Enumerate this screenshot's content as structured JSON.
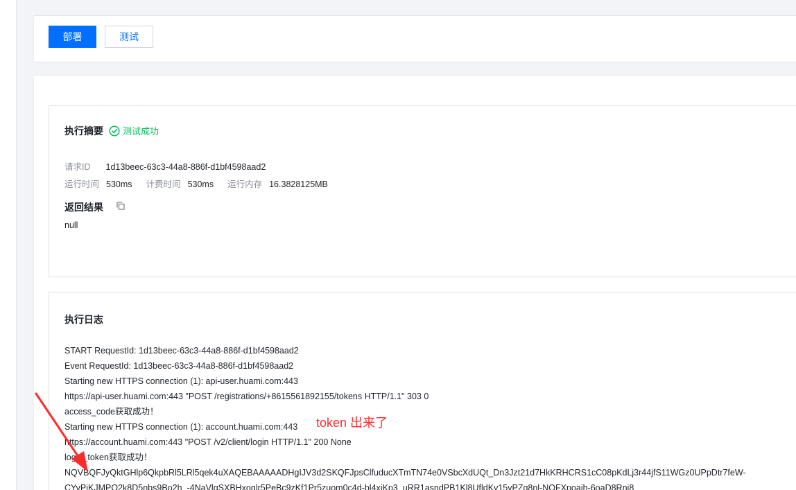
{
  "toolbar": {
    "deploy_label": "部署",
    "test_label": "测试"
  },
  "summary": {
    "title": "执行摘要",
    "status": "测试成功",
    "request_id_label": "请求ID",
    "request_id": "1d13beec-63c3-44a8-886f-d1bf4598aad2",
    "run_time_label": "运行时间",
    "run_time": "530ms",
    "bill_time_label": "计费时间",
    "bill_time": "530ms",
    "memory_label": "运行内存",
    "memory": "16.3828125MB",
    "result_title": "返回结果",
    "result_value": "null"
  },
  "log": {
    "title": "执行日志",
    "lines": [
      "START RequestId: 1d13beec-63c3-44a8-886f-d1bf4598aad2",
      "Event RequestId: 1d13beec-63c3-44a8-886f-d1bf4598aad2",
      "Starting new HTTPS connection (1): api-user.huami.com:443",
      "https://api-user.huami.com:443 \"POST /registrations/+8615561892155/tokens HTTP/1.1\" 303 0",
      "access_code获取成功！",
      "Starting new HTTPS connection (1): account.huami.com:443",
      "https://account.huami.com:443 \"POST /v2/client/login HTTP/1.1\" 200 None",
      "login_token获取成功！",
      "NQVBQFJyQktGHlp6QkpbRl5LRl5qek4uXAQEBAAAAADHgIJV3d2SKQFJpsClfuducXTmTN74e0VSbcXdUQt_Dn3Jzt21d7HkKRHCRS1cC08pKdLj3r44jfS11WGz0UPpDtr7feW-",
      "CYvPiKJMPQ2k8D5nbs9Bo2h_-4NaVlgSXBHxoglr5PeBc9zKf1Pr5zuom0c4d-bl4xiKp3_uRR1asndPB1Kl8UfldKv15vPZg8nl-NOFXpoaih-6oaD8Rni8"
    ]
  },
  "annotation": {
    "text": "token 出来了"
  },
  "colors": {
    "primary": "#006eff",
    "success": "#0abf5b",
    "annotation": "#ff2a2a"
  }
}
